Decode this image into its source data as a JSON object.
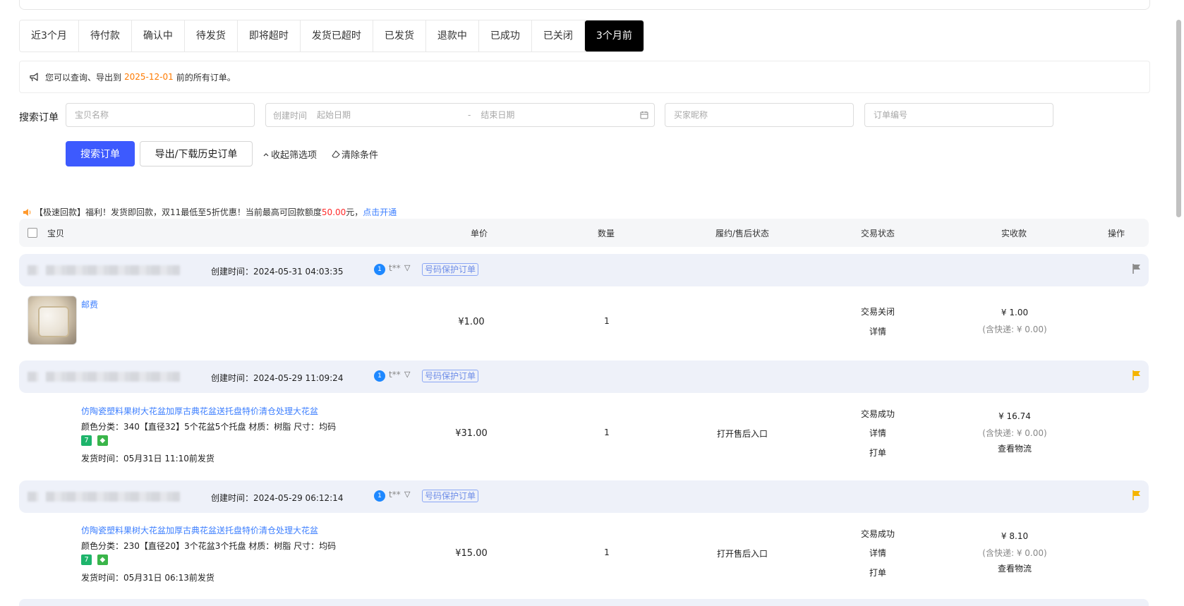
{
  "tabs": [
    {
      "label": "近3个月",
      "active": false
    },
    {
      "label": "待付款",
      "active": false
    },
    {
      "label": "确认中",
      "active": false
    },
    {
      "label": "待发货",
      "active": false
    },
    {
      "label": "即将超时",
      "active": false
    },
    {
      "label": "发货已超时",
      "active": false
    },
    {
      "label": "已发货",
      "active": false
    },
    {
      "label": "退款中",
      "active": false
    },
    {
      "label": "已成功",
      "active": false
    },
    {
      "label": "已关闭",
      "active": false
    },
    {
      "label": "3个月前",
      "active": true
    }
  ],
  "notice": {
    "icon": "megaphone-icon",
    "prefix": "您可以查询、导出到",
    "date": "2025-12-01",
    "suffix": "前的所有订单。",
    "date_color": "#ff7a00"
  },
  "search": {
    "label": "搜索订单",
    "item_name_placeholder": "宝贝名称",
    "create_time_label": "创建时间",
    "start_date_placeholder": "起始日期",
    "date_separator": "-",
    "end_date_placeholder": "结束日期",
    "buyer_nick_placeholder": "买家昵称",
    "order_no_placeholder": "订单编号",
    "search_button": "搜索订单",
    "export_button": "导出/下载历史订单",
    "collapse_filter": "收起筛选项",
    "clear_conditions": "清除条件",
    "primary_color": "#3d5afe"
  },
  "promo": {
    "icon": "speaker-icon",
    "text": "【极速回款】福利！发货即回款，双11最低至5折优惠！当前最高可回款额度",
    "amount": "50.00",
    "unit": "元，",
    "link": "点击开通"
  },
  "table_header": {
    "item": "宝贝",
    "unit_price": "单价",
    "quantity": "数量",
    "fulfillment": "履约/售后状态",
    "trade_status": "交易状态",
    "received": "实收款",
    "actions": "操作"
  },
  "orders": [
    {
      "create_time": "创建时间：2024-05-31 04:03:35",
      "buyer_nick": "t**",
      "protect_badge": "号码保护订单",
      "flag_color": "#8c8c8c",
      "item_title": "邮费",
      "price": "¥1.00",
      "quantity": "1",
      "trade_status": "交易关闭",
      "detail_link": "详情",
      "received": "¥ 1.00",
      "shipping_note": "(含快递: ¥ 0.00)"
    },
    {
      "create_time": "创建时间：2024-05-29 11:09:24",
      "buyer_nick": "t**",
      "protect_badge": "号码保护订单",
      "flag_color": "#f5b400",
      "item_title": "仿陶瓷塑料果树大花盆加厚古典花盆送托盘特价清仓处理大花盆",
      "item_spec": "颜色分类：340【直径32】5个花盆5个托盘  材质：树脂  尺寸：均码",
      "ship_time": "发货时间：05月31日 11:10前发货",
      "price": "¥31.00",
      "quantity": "1",
      "after_sale_link": "打开售后入口",
      "trade_status": "交易成功",
      "detail_link": "详情",
      "print_link": "打单",
      "received": "¥ 16.74",
      "shipping_note": "(含快递: ¥ 0.00)",
      "logistics_link": "查看物流"
    },
    {
      "create_time": "创建时间：2024-05-29 06:12:14",
      "buyer_nick": "t**",
      "protect_badge": "号码保护订单",
      "flag_color": "#f5b400",
      "item_title": "仿陶瓷塑料果树大花盆加厚古典花盆送托盘特价清仓处理大花盆",
      "item_spec": "颜色分类：230【直径20】3个花盆3个托盘  材质：树脂  尺寸：均码",
      "ship_time": "发货时间：05月31日 06:13前发货",
      "price": "¥15.00",
      "quantity": "1",
      "after_sale_link": "打开售后入口",
      "trade_status": "交易成功",
      "detail_link": "详情",
      "print_link": "打单",
      "received": "¥ 8.10",
      "shipping_note": "(含快递: ¥ 0.00)",
      "logistics_link": "查看物流"
    }
  ],
  "service_tags": [
    {
      "icon": "seven-day-return-icon",
      "glyph": "7",
      "color": "#1db46b"
    },
    {
      "icon": "shield-guarantee-icon",
      "glyph": "◆",
      "color": "#3ab54a"
    }
  ]
}
